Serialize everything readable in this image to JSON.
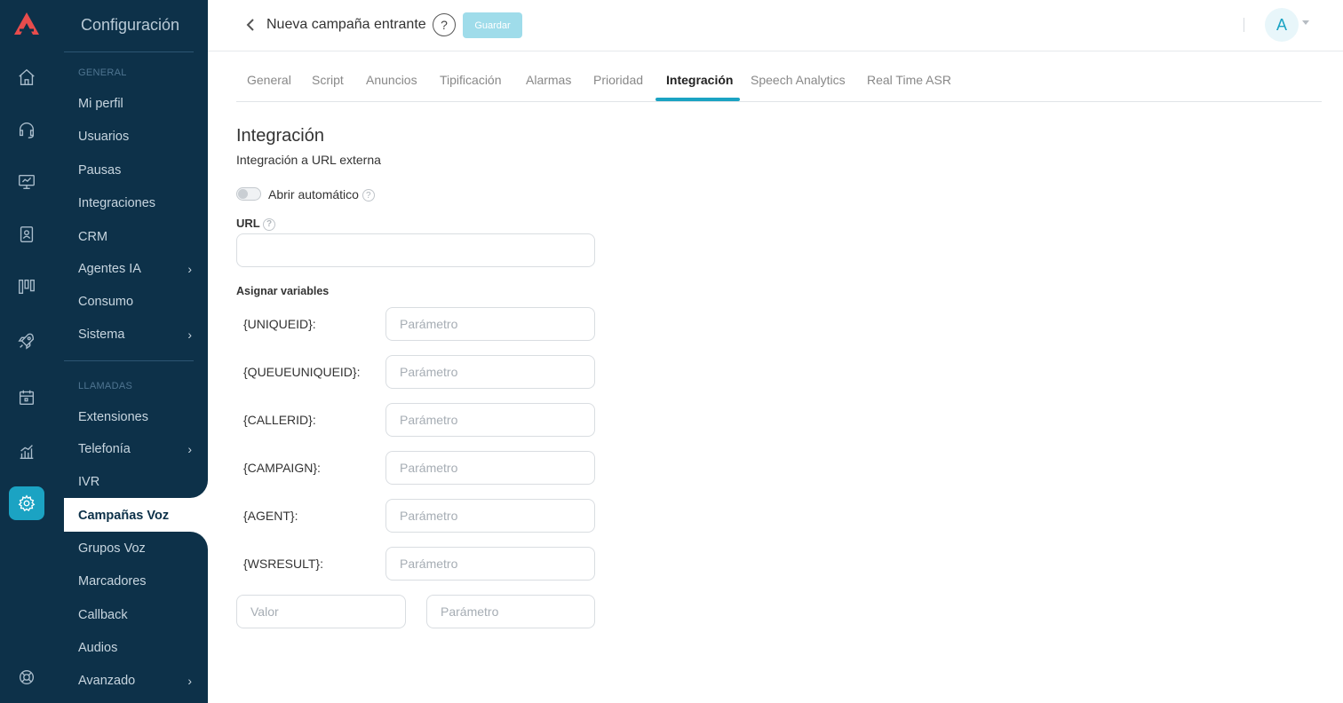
{
  "sidebar": {
    "title": "Configuración",
    "sections": [
      {
        "label": "GENERAL"
      },
      {
        "label": "LLAMADAS"
      }
    ],
    "items": [
      {
        "label": "Mi perfil"
      },
      {
        "label": "Usuarios"
      },
      {
        "label": "Pausas"
      },
      {
        "label": "Integraciones"
      },
      {
        "label": "CRM"
      },
      {
        "label": "Agentes IA"
      },
      {
        "label": "Consumo"
      },
      {
        "label": "Sistema"
      },
      {
        "label": "Extensiones"
      },
      {
        "label": "Telefonía"
      },
      {
        "label": "IVR"
      },
      {
        "label": "Campañas Voz"
      },
      {
        "label": "Grupos Voz"
      },
      {
        "label": "Marcadores"
      },
      {
        "label": "Callback"
      },
      {
        "label": "Audios"
      },
      {
        "label": "Avanzado"
      }
    ],
    "chevron": "›"
  },
  "header": {
    "title": "Nueva campaña entrante",
    "help": "?",
    "save_label": "Guardar",
    "avatar": "A"
  },
  "tabs": [
    {
      "label": "General"
    },
    {
      "label": "Script"
    },
    {
      "label": "Anuncios"
    },
    {
      "label": "Tipificación"
    },
    {
      "label": "Alarmas"
    },
    {
      "label": "Prioridad"
    },
    {
      "label": "Integración"
    },
    {
      "label": "Speech Analytics"
    },
    {
      "label": "Real Time ASR"
    }
  ],
  "content": {
    "title": "Integración",
    "subtitle": "Integración a URL externa",
    "toggle_label": "Abrir automático",
    "url_label": "URL",
    "url_value": "",
    "vars_label": "Asignar variables",
    "variables": [
      {
        "name": "{UNIQUEID}:",
        "placeholder": "Parámetro"
      },
      {
        "name": "{QUEUEUNIQUEID}:",
        "placeholder": "Parámetro"
      },
      {
        "name": "{CALLERID}:",
        "placeholder": "Parámetro"
      },
      {
        "name": "{CAMPAIGN}:",
        "placeholder": "Parámetro"
      },
      {
        "name": "{AGENT}:",
        "placeholder": "Parámetro"
      },
      {
        "name": "{WSRESULT}:",
        "placeholder": "Parámetro"
      }
    ],
    "custom_value_placeholder": "Valor",
    "custom_param_placeholder": "Parámetro"
  },
  "colors": {
    "sidebar_bg": "#0d3149",
    "accent": "#1ba3c3",
    "save_disabled": "#9fdcea",
    "logo": "#e84c4c"
  },
  "icons": {
    "rail": [
      "home-icon",
      "headset-icon",
      "monitor-icon",
      "contacts-icon",
      "kanban-icon",
      "rocket-icon",
      "calendar-icon",
      "stats-icon",
      "settings-icon",
      "support-icon"
    ]
  }
}
